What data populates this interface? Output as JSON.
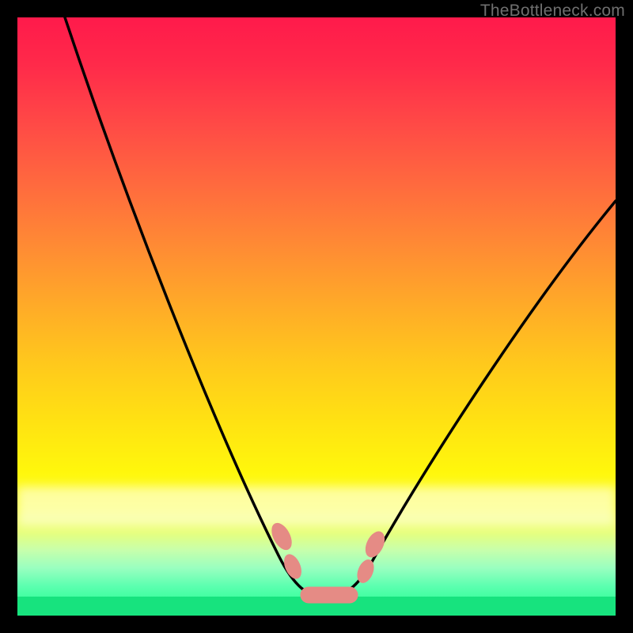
{
  "watermark": "TheBottleneck.com",
  "chart_data": {
    "type": "line",
    "title": "",
    "xlabel": "",
    "ylabel": "",
    "xlim": [
      0,
      100
    ],
    "ylim": [
      0,
      100
    ],
    "series": [
      {
        "name": "bottleneck-curve",
        "x": [
          8,
          12,
          16,
          20,
          24,
          28,
          32,
          36,
          40,
          42,
          44,
          46,
          48,
          50,
          52,
          54,
          56,
          58,
          62,
          66,
          70,
          74,
          78,
          82,
          86,
          90,
          94,
          98,
          100
        ],
        "y": [
          100,
          92,
          84,
          76,
          68,
          60,
          52,
          44,
          34,
          28,
          22,
          16,
          11,
          7,
          4,
          4,
          4,
          7,
          12,
          18,
          24,
          30,
          36,
          42,
          48,
          54,
          60,
          66,
          69
        ]
      }
    ],
    "markers": {
      "name": "optimal-range-markers",
      "color": "#e58b85",
      "points": [
        {
          "x": 44.5,
          "y": 14
        },
        {
          "x": 46,
          "y": 7
        },
        {
          "x": 49,
          "y": 4
        },
        {
          "x": 52,
          "y": 4
        },
        {
          "x": 55,
          "y": 4
        },
        {
          "x": 57.5,
          "y": 7
        },
        {
          "x": 59,
          "y": 11
        }
      ]
    },
    "color_scale": {
      "top": "#ff1a4b",
      "mid": "#ffe312",
      "bottom": "#17e37e"
    }
  }
}
